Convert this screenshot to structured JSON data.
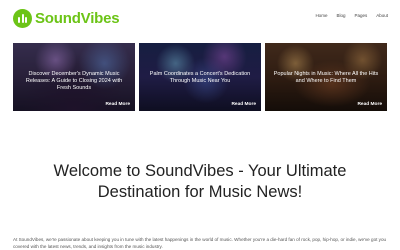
{
  "site": {
    "name": "SoundVibes",
    "brand_color": "#6cc417",
    "logo_icon": "music-bars-icon"
  },
  "nav": {
    "items": [
      {
        "label": "Home"
      },
      {
        "label": "Blog"
      },
      {
        "label": "Pages"
      },
      {
        "label": "About"
      }
    ]
  },
  "cards": [
    {
      "title": "Discover December's Dynamic Music Releases: A Guide to Closing 2024 with Fresh Sounds",
      "cta": "Read More"
    },
    {
      "title": "Palm Coordinates a Concert's Dedication Through Music Near You",
      "cta": "Read More"
    },
    {
      "title": "Popular Nights in Music: Where All the Hits and Where to Find Them",
      "cta": "Read More"
    }
  ],
  "hero": {
    "headline": "Welcome to SoundVibes - Your Ultimate Destination for Music News!"
  },
  "intro": {
    "text": "At SoundVibes, we're passionate about keeping you in tune with the latest happenings in the world of music. Whether you're a die-hard fan of rock, pop, hip-hop, or indie, we've got you covered with the latest news, trends, and insights from the music industry."
  }
}
